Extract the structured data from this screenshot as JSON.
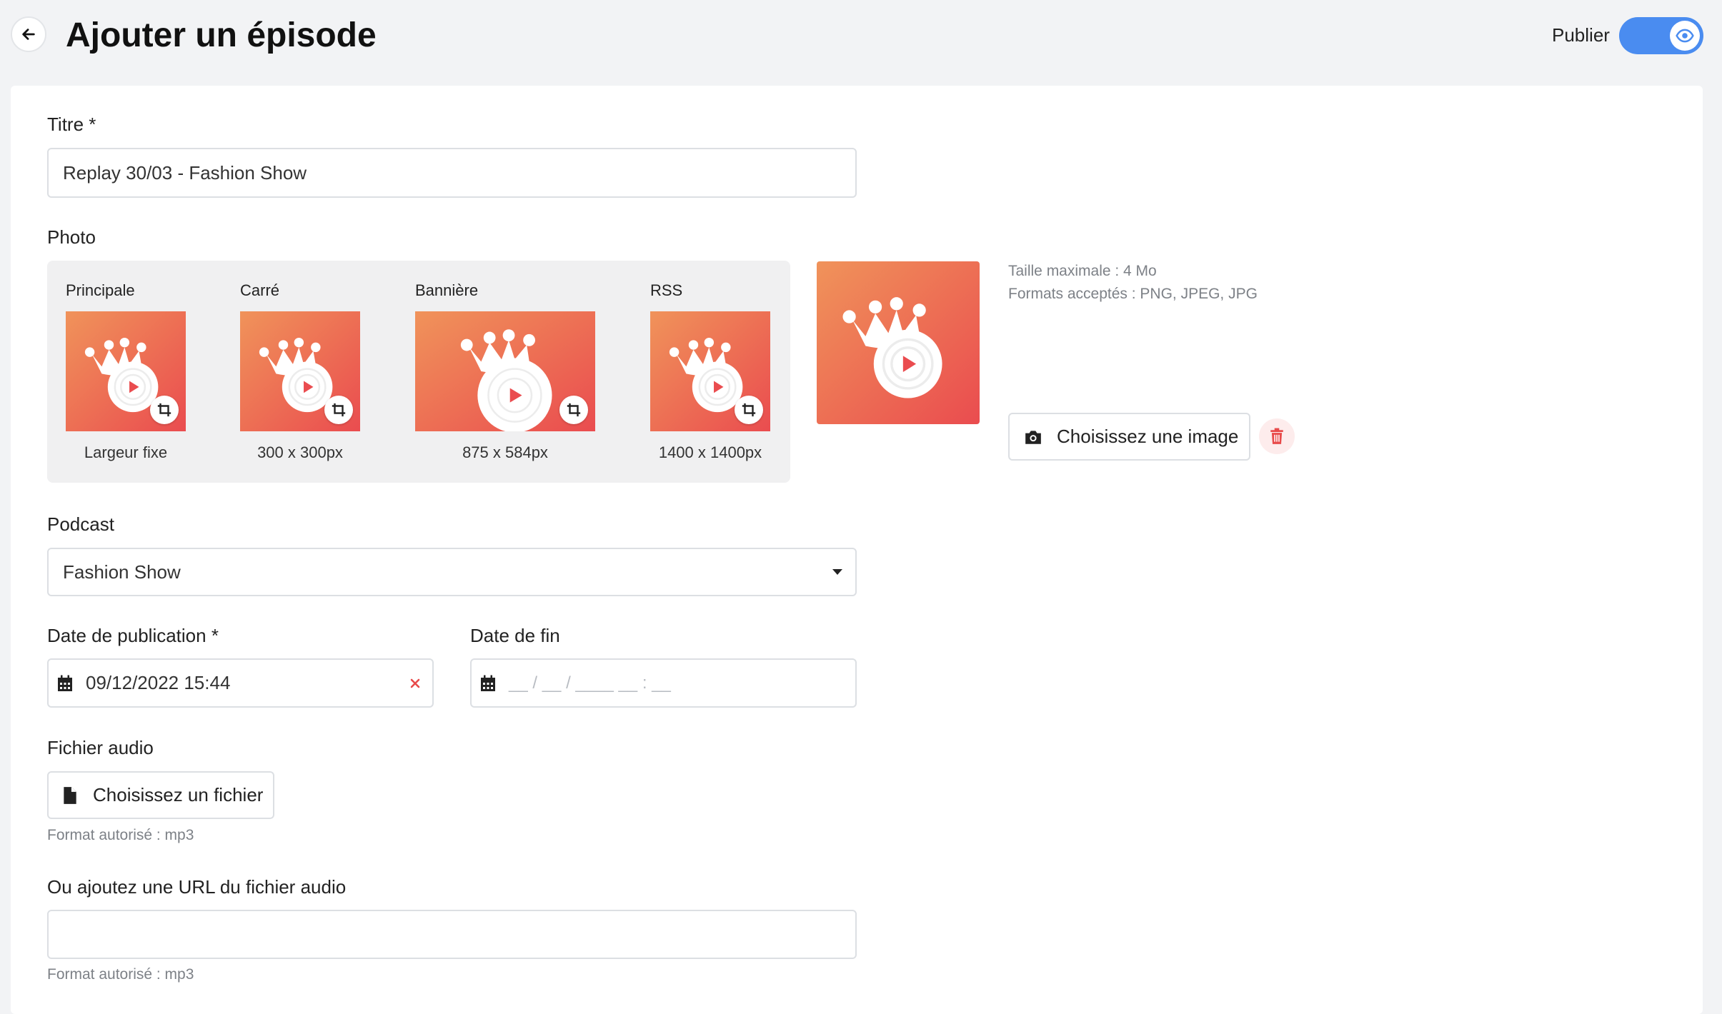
{
  "header": {
    "title": "Ajouter un épisode",
    "publish_label": "Publier",
    "publish_enabled": true
  },
  "form": {
    "title_label": "Titre *",
    "title_value": "Replay 30/03 - Fashion Show",
    "photo_label": "Photo",
    "photo_variants": [
      {
        "name": "Principale",
        "size": "Largeur fixe"
      },
      {
        "name": "Carré",
        "size": "300 x 300px"
      },
      {
        "name": "Bannière",
        "size": "875 x 584px"
      },
      {
        "name": "RSS",
        "size": "1400 x 1400px"
      }
    ],
    "photo_hint_size": "Taille maximale : 4 Mo",
    "photo_hint_formats": "Formats acceptés : PNG, JPEG, JPG",
    "choose_image_label": "Choisissez une image",
    "podcast_label": "Podcast",
    "podcast_value": "Fashion Show",
    "pub_date_label": "Date de publication *",
    "pub_date_value": "09/12/2022 15:44",
    "end_date_label": "Date de fin",
    "end_date_placeholder": "__ / __ / ____ __ : __",
    "audio_label": "Fichier audio",
    "choose_file_label": "Choisissez un fichier",
    "audio_format_hint": "Format autorisé : mp3",
    "url_label": "Ou ajoutez une URL du fichier audio",
    "url_value": "",
    "url_format_hint": "Format autorisé : mp3"
  },
  "colors": {
    "accent": "#4a8cf0",
    "gradient_start": "#f0935a",
    "gradient_end": "#ea4c4f",
    "danger": "#e84a4a"
  }
}
